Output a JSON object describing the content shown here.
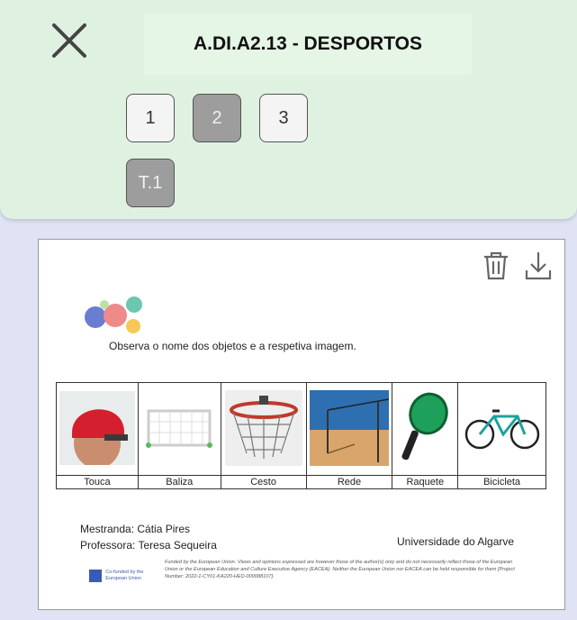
{
  "header": {
    "title": "A.DI.A2.13 - DESPORTOS",
    "close_icon": "close-icon",
    "pages": [
      {
        "label": "1",
        "active": false
      },
      {
        "label": "2",
        "active": true
      },
      {
        "label": "3",
        "active": false
      }
    ],
    "task_button": "T.1"
  },
  "toolbar": {
    "delete_icon": "trash-icon",
    "download_icon": "download-icon"
  },
  "document": {
    "instruction": "Observa o nome dos objetos e a respetiva imagem.",
    "objects": [
      {
        "label": "Touca",
        "icon": "swim-cap-image"
      },
      {
        "label": "Baliza",
        "icon": "goal-image"
      },
      {
        "label": "Cesto",
        "icon": "basketball-hoop-image"
      },
      {
        "label": "Rede",
        "icon": "volleyball-net-image"
      },
      {
        "label": "Raquete",
        "icon": "racket-image"
      },
      {
        "label": "Bicicleta",
        "icon": "bicycle-image"
      }
    ],
    "student": "Mestranda: Cátia Pires",
    "teacher": "Professora: Teresa Sequeira",
    "university": "Universidade do Algarve",
    "eu_logo_text": "Co-funded by the European Union",
    "disclaimer": "Funded by the European Union. Views and opinions expressed are however those of the author(s) only and do not necessarily reflect those of the European Union or the European Education and Culture Executive Agency (EACEA). Neither the European Union nor EACEA can be held responsible for them [Project Number: 2022-1-CY01-KA220-HED-000088107]."
  },
  "colors": {
    "background": "#dfe3f3",
    "header": "#dff2e2",
    "active_page": "#9d9d9d"
  }
}
